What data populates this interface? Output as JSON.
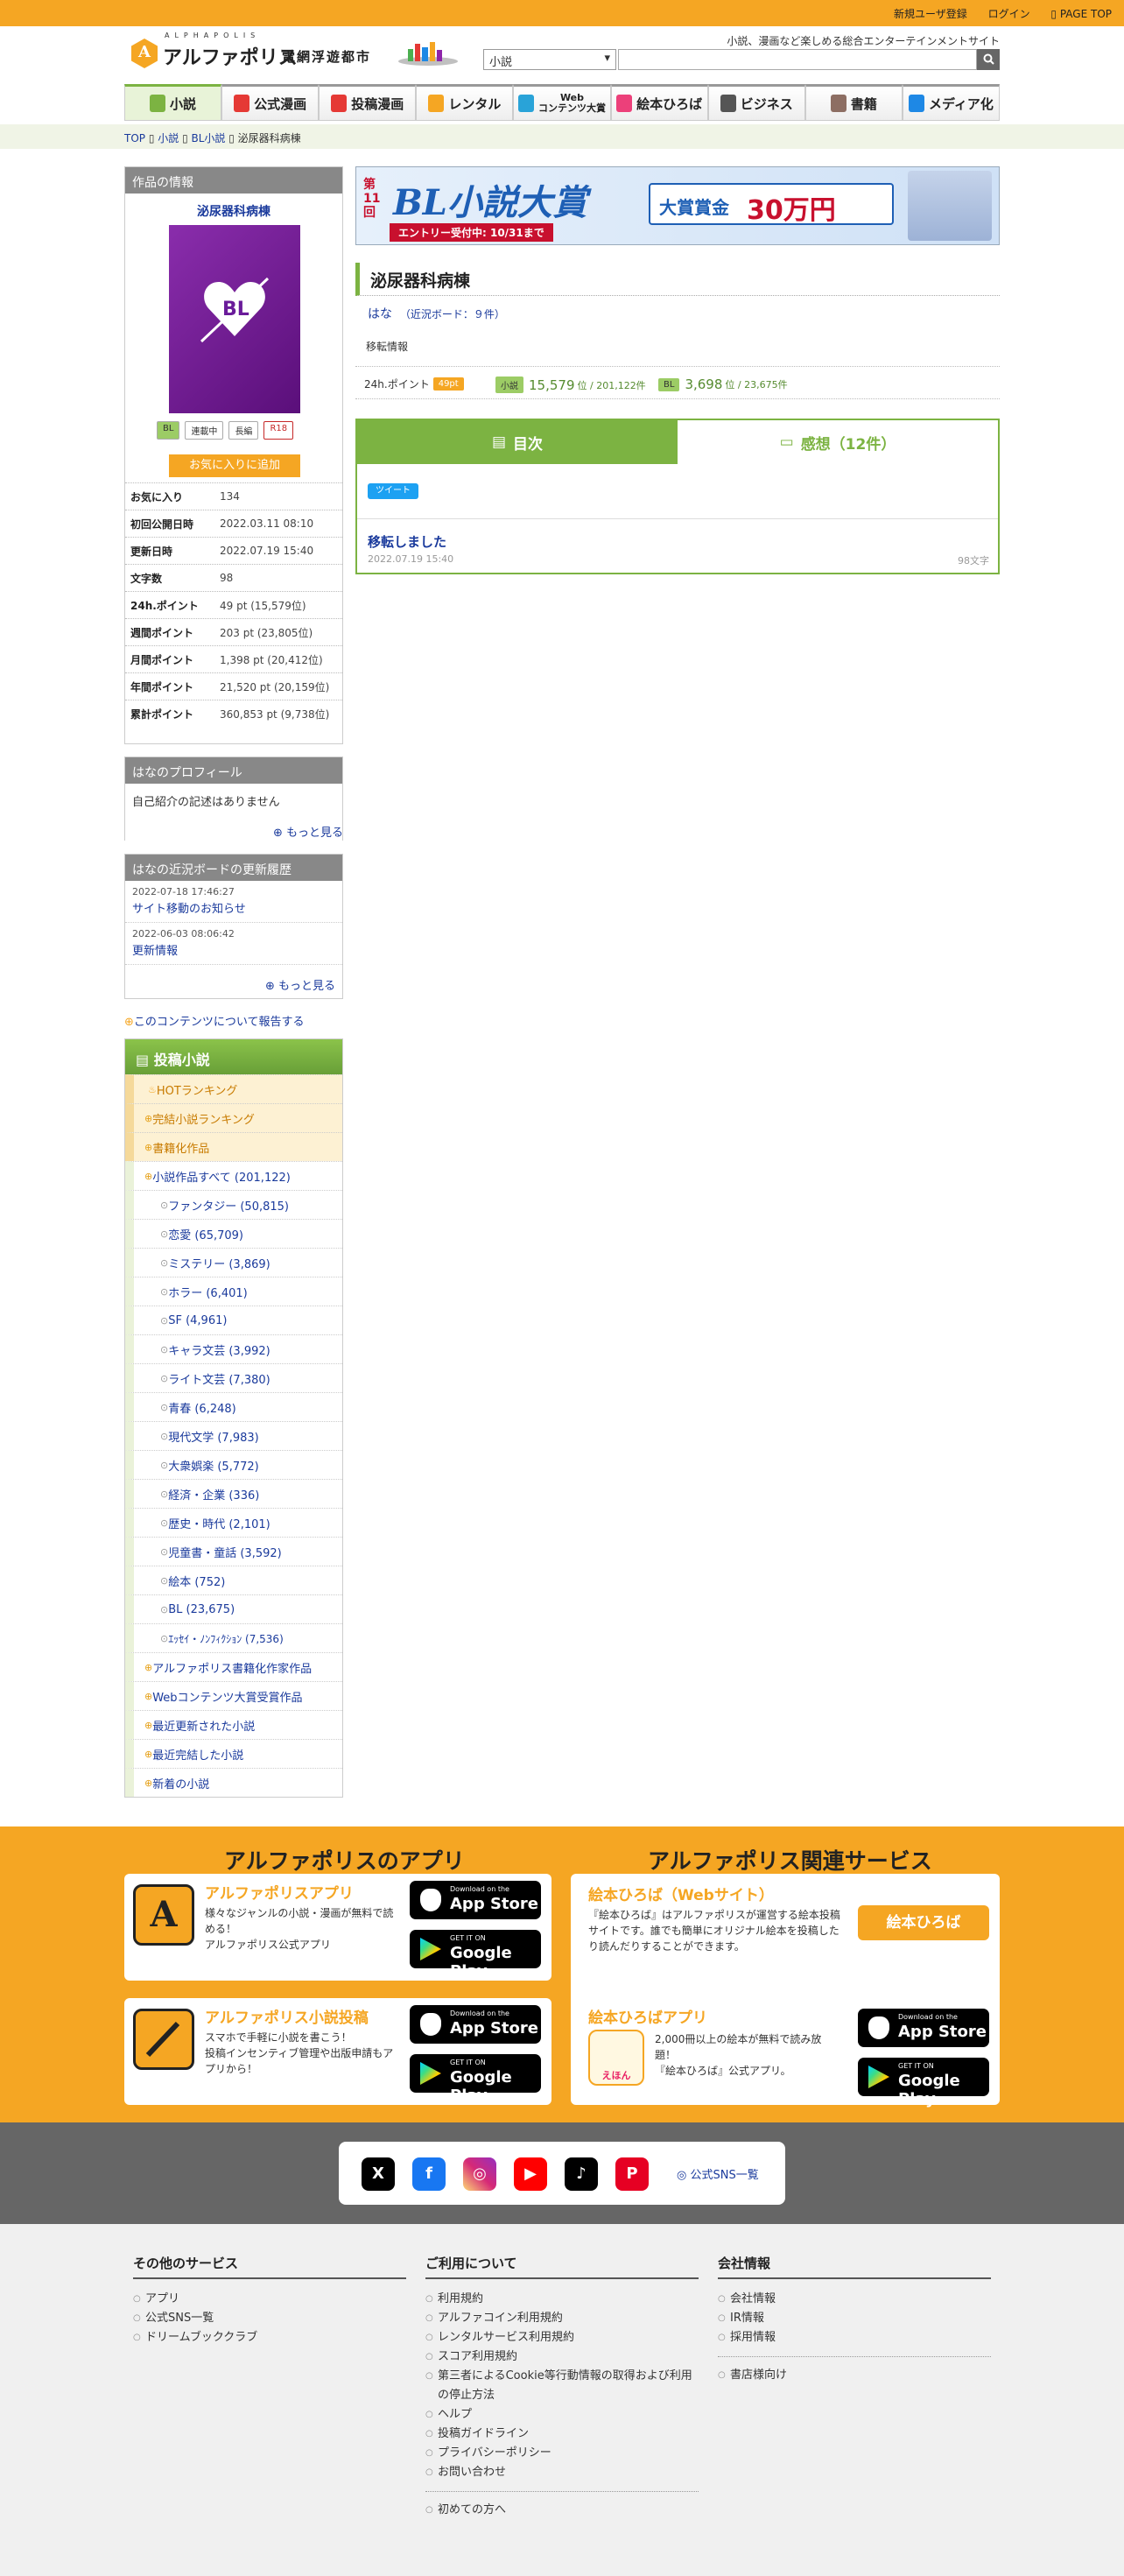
{
  "topbar": {
    "register": "新規ユーザ登録",
    "login": "ログイン",
    "pagetop": "▯ PAGE TOP"
  },
  "header": {
    "logo_ruby": "ALPHAPOLIS",
    "logo": "アルファポリス",
    "logo_sub": "電網浮遊都市",
    "tagline": "小説、漫画など楽しめる総合エンターテインメントサイト",
    "search_select": "小説",
    "search_placeholder": ""
  },
  "nav": [
    {
      "label": "小説",
      "color": "#7cb342"
    },
    {
      "label": "公式漫画",
      "color": "#e53935"
    },
    {
      "label": "投稿漫画",
      "color": "#e53935"
    },
    {
      "label": "レンタル",
      "color": "#f5a623"
    },
    {
      "label": "Web\nコンテンツ大賞",
      "color": "#29a3d8"
    },
    {
      "label": "絵本ひろば",
      "color": "#ec407a"
    },
    {
      "label": "ビジネス",
      "color": "#555555"
    },
    {
      "label": "書籍",
      "color": "#8d6e63"
    },
    {
      "label": "メディア化",
      "color": "#1e88e5"
    }
  ],
  "breadcrumb": [
    "TOP",
    "小説",
    "BL小説",
    "泌尿器科病棟"
  ],
  "info": {
    "head": "作品の情報",
    "title": "泌尿器科病棟",
    "cover_text": "BL",
    "tags": [
      "BL",
      "連載中",
      "長編",
      "R18"
    ],
    "fav_button": "お気に入りに追加",
    "stats": [
      {
        "k": "お気に入り",
        "v": "134"
      },
      {
        "k": "初回公開日時",
        "v": "2022.03.11 08:10"
      },
      {
        "k": "更新日時",
        "v": "2022.07.19 15:40"
      },
      {
        "k": "文字数",
        "v": "98"
      },
      {
        "k": "24h.ポイント",
        "v": "49 pt (15,579位)"
      },
      {
        "k": "週間ポイント",
        "v": "203 pt (23,805位)"
      },
      {
        "k": "月間ポイント",
        "v": "1,398 pt (20,412位)"
      },
      {
        "k": "年間ポイント",
        "v": "21,520 pt (20,159位)"
      },
      {
        "k": "累計ポイント",
        "v": "360,853 pt (9,738位)"
      }
    ]
  },
  "profile": {
    "head": "はなのプロフィール",
    "text": "自己紹介の記述はありません",
    "more": "もっと見る"
  },
  "board": {
    "head": "はなの近況ボードの更新履歴",
    "items": [
      {
        "date": "2022-07-18 17:46:27",
        "title": "サイト移動のお知らせ"
      },
      {
        "date": "2022-06-03 08:06:42",
        "title": "更新情報"
      }
    ],
    "more": "もっと見る"
  },
  "report": "このコンテンツについて報告する",
  "sidenav": {
    "head": "投稿小説",
    "items": [
      {
        "label": "HOTランキング",
        "level": 0,
        "hl": true
      },
      {
        "label": "完結小説ランキング",
        "level": 0,
        "hl": true
      },
      {
        "label": "書籍化作品",
        "level": 0,
        "hl": true
      },
      {
        "label": "小説作品すべて (201,122)",
        "level": 0,
        "hl": false
      },
      {
        "label": "ファンタジー (50,815)",
        "level": 1
      },
      {
        "label": "恋愛 (65,709)",
        "level": 1
      },
      {
        "label": "ミステリー (3,869)",
        "level": 1
      },
      {
        "label": "ホラー (6,401)",
        "level": 1
      },
      {
        "label": "SF (4,961)",
        "level": 1
      },
      {
        "label": "キャラ文芸 (3,992)",
        "level": 1
      },
      {
        "label": "ライト文芸 (7,380)",
        "level": 1
      },
      {
        "label": "青春 (6,248)",
        "level": 1
      },
      {
        "label": "現代文学 (7,983)",
        "level": 1
      },
      {
        "label": "大衆娯楽 (5,772)",
        "level": 1
      },
      {
        "label": "経済・企業 (336)",
        "level": 1
      },
      {
        "label": "歴史・時代 (2,101)",
        "level": 1
      },
      {
        "label": "児童書・童話 (3,592)",
        "level": 1
      },
      {
        "label": "絵本 (752)",
        "level": 1
      },
      {
        "label": "BL (23,675)",
        "level": 1
      },
      {
        "label": "ｴｯｾｲ・ﾉﾝﾌｨｸｼｮﾝ (7,536)",
        "level": 1
      },
      {
        "label": "アルファポリス書籍化作家作品",
        "level": 0,
        "hl": false
      },
      {
        "label": "Webコンテンツ大賞受賞作品",
        "level": 0,
        "hl": false
      },
      {
        "label": "最近更新された小説",
        "level": 0,
        "hl": false
      },
      {
        "label": "最近完結した小説",
        "level": 0,
        "hl": false
      },
      {
        "label": "新着の小説",
        "level": 0,
        "hl": false
      }
    ]
  },
  "banner": {
    "kai": "第11回",
    "title": "BL小説大賞",
    "entry": "エントリー受付中: 10/31まで",
    "prize_label": "大賞賞金",
    "prize": "30万円"
  },
  "work": {
    "title": "泌尿器科病棟",
    "author": "はな",
    "board": "（近況ボード：９件）",
    "desc": "移転情報",
    "pts_label": "24h.ポイント",
    "pts": "49pt",
    "novel_badge": "小説",
    "novel_rank": "15,579",
    "novel_total": "位 / 201,122件",
    "bl_badge": "BL",
    "bl_rank": "3,698",
    "bl_total": "位 / 23,675件"
  },
  "tabs": {
    "toc": "目次",
    "reviews": "感想（12件）"
  },
  "tweet": "ツイート",
  "chapter": {
    "title": "移転しました",
    "date": "2022.07.19 15:40",
    "len": "98文字"
  },
  "apps": {
    "left_head": "アルファポリスのアプリ",
    "right_head": "アルファポリス関連サービス",
    "app1": {
      "title": "アルファポリスアプリ",
      "desc": "様々なジャンルの小説・漫画が無料で読める！\nアルファポリス公式アプリ"
    },
    "app2": {
      "title": "アルファポリス小説投稿",
      "desc": "スマホで手軽に小説を書こう！\n投稿インセンティブ管理や出版申請もアプリから！"
    },
    "ehon": {
      "title": "絵本ひろば（Webサイト）",
      "desc": "『絵本ひろば』はアルファポリスが運営する絵本投稿サイトです。誰でも簡単にオリジナル絵本を投稿したり読んだりすることができます。",
      "button": "絵本ひろば"
    },
    "ehonapp": {
      "title": "絵本ひろばアプリ",
      "desc": "2,000冊以上の絵本が無料で読み放題！\n『絵本ひろば』公式アプリ。",
      "icon_text": "えほん"
    },
    "appstore_top": "Download on the",
    "appstore": "App Store",
    "gplay_top": "GET IT ON",
    "gplay": "Google Play"
  },
  "sns": {
    "more": "公式SNS一覧",
    "icons": [
      "x-icon",
      "facebook-icon",
      "instagram-icon",
      "youtube-icon",
      "tiktok-icon",
      "pinterest-icon"
    ]
  },
  "footer": {
    "col1": {
      "head": "その他のサービス",
      "items": [
        "アプリ",
        "公式SNS一覧",
        "ドリームブッククラブ"
      ]
    },
    "col2": {
      "head": "ご利用について",
      "items": [
        "利用規約",
        "アルファコイン利用規約",
        "レンタルサービス利用規約",
        "スコア利用規約",
        "第三者によるCookie等行動情報の取得および利用の停止方法",
        "ヘルプ",
        "投稿ガイドライン",
        "プライバシーポリシー",
        "お問い合わせ"
      ],
      "extra": "初めての方へ"
    },
    "col3": {
      "head": "会社情報",
      "items": [
        "会社情報",
        "IR情報",
        "採用情報"
      ],
      "extra": "書店様向け"
    }
  }
}
